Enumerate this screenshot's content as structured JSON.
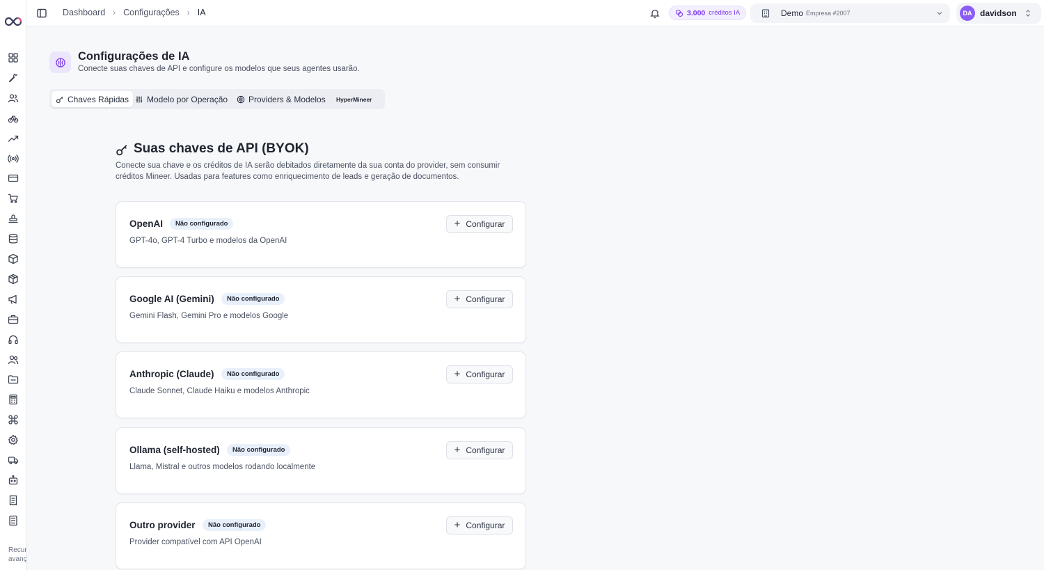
{
  "sidebar": {
    "nav_icons": [
      "dashboard-icon",
      "wrench-icon",
      "users-icon",
      "bike-icon",
      "trending-icon",
      "radio-icon",
      "card-icon",
      "cart-icon",
      "stamp-icon",
      "database-icon",
      "package-icon",
      "box-icon",
      "megaphone-icon",
      "briefcase-icon",
      "headphones-icon",
      "user-group-icon",
      "folder-icon",
      "calculator-icon",
      "command-icon",
      "gear-icon",
      "truck-icon",
      "bot-icon",
      "receipt-icon",
      "calc-icon"
    ],
    "footer_text_1": "Recur",
    "footer_text_2": "avanç"
  },
  "header": {
    "breadcrumbs": [
      "Dashboard",
      "Configurações",
      "IA"
    ],
    "credits_value": "3.000",
    "credits_label": "créditos IA",
    "company_name": "Demo",
    "company_sub": "Empresa #2007",
    "avatar_initials": "DA",
    "user_name": "davidson"
  },
  "page": {
    "title": "Configurações de IA",
    "subtitle": "Conecte suas chaves de API e configure os modelos que seus agentes usarão."
  },
  "tabs": [
    {
      "label": "Chaves Rápidas",
      "icon": "key-icon",
      "active": true
    },
    {
      "label": "Modelo por Operação",
      "icon": "sliders-icon",
      "active": false
    },
    {
      "label": "Providers & Modelos",
      "icon": "brain-icon",
      "active": false
    }
  ],
  "tab_badge": "HyperMineer",
  "section": {
    "title": "Suas chaves de API (BYOK)",
    "description": "Conecte sua chave e os créditos de IA serão debitados diretamente da sua conta do provider, sem consumir créditos Mineer. Usadas para features como enriquecimento de leads e geração de documentos."
  },
  "providers": [
    {
      "name": "OpenAI",
      "status": "Não configurado",
      "description": "GPT-4o, GPT-4 Turbo e modelos da OpenAI",
      "button": "Configurar"
    },
    {
      "name": "Google AI (Gemini)",
      "status": "Não configurado",
      "description": "Gemini Flash, Gemini Pro e modelos Google",
      "button": "Configurar"
    },
    {
      "name": "Anthropic (Claude)",
      "status": "Não configurado",
      "description": "Claude Sonnet, Claude Haiku e modelos Anthropic",
      "button": "Configurar"
    },
    {
      "name": "Ollama (self-hosted)",
      "status": "Não configurado",
      "description": "Llama, Mistral e outros modelos rodando localmente",
      "button": "Configurar"
    },
    {
      "name": "Outro provider",
      "status": "Não configurado",
      "description": "Provider compatível com API OpenAI",
      "button": "Configurar"
    }
  ],
  "colors": {
    "accent": "#7c3aed",
    "badge_bg": "#e8f1fb"
  }
}
